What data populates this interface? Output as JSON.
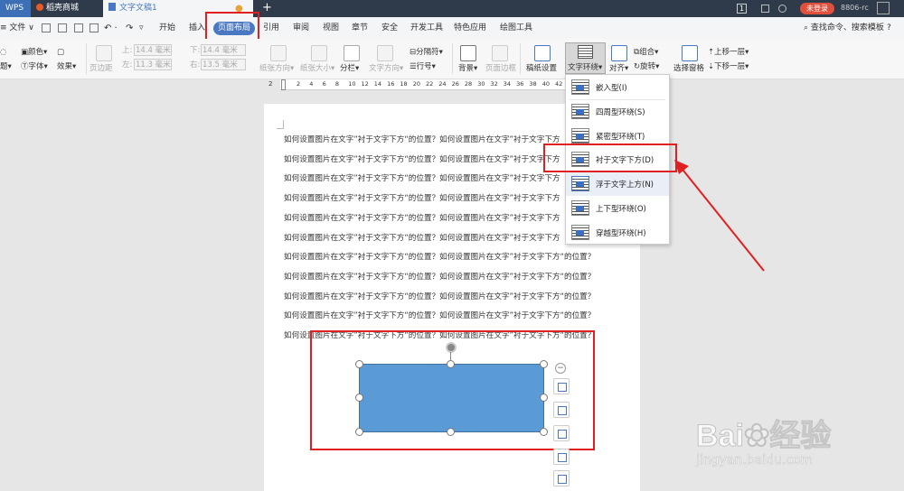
{
  "titlebar": {
    "tabs": [
      {
        "label": "WPS"
      },
      {
        "label": "稻壳商城"
      },
      {
        "label": "文字文稿1"
      }
    ],
    "new_tab": "+",
    "page_count": "1",
    "login_button": "未登录",
    "user_id": "8806-rc"
  },
  "menu": {
    "file": "文件",
    "items": [
      "开始",
      "插入",
      "页面布局",
      "引用",
      "审阅",
      "视图",
      "章节",
      "安全",
      "开发工具",
      "特色应用",
      "绘图工具"
    ],
    "search": "查找命令、搜索模板",
    "help": "?"
  },
  "ribbon": {
    "theme": "题",
    "colors": "颜色",
    "fonts": "字体",
    "effects": "效果",
    "margins": "页边距",
    "top_label": "上:",
    "top_value": "14.4 毫米",
    "bottom_label": "下:",
    "bottom_value": "14.4 毫米",
    "left_label": "左:",
    "left_value": "11.3 毫米",
    "right_label": "右:",
    "right_value": "13.5 毫米",
    "orientation": "纸张方向",
    "size": "纸张大小",
    "columns": "分栏",
    "text_direction": "文字方向",
    "separator": "分隔符",
    "line_numbers": "行号",
    "background": "背景",
    "page_border": "页面边框",
    "manuscript": "稿纸设置",
    "text_wrap": "文字环绕",
    "align": "对齐",
    "group": "组合",
    "rotate": "旋转",
    "selection_pane": "选择窗格",
    "bring_forward": "上移一层",
    "send_backward": "下移一层"
  },
  "ruler": {
    "start": "2",
    "marks": [
      "2",
      "4",
      "6",
      "8",
      "10",
      "12",
      "14",
      "16",
      "18",
      "20",
      "22",
      "24",
      "26",
      "28",
      "30",
      "32",
      "34",
      "36",
      "38",
      "40",
      "42"
    ]
  },
  "document": {
    "lines_short": [
      "如何设置图片在文字”衬于文字下方“的位置？如何设置图片在文字”衬于文字下方",
      "如何设置图片在文字”衬于文字下方“的位置？如何设置图片在文字”衬于文字下方",
      "如何设置图片在文字”衬于文字下方“的位置？如何设置图片在文字”衬于文字下方",
      "如何设置图片在文字”衬于文字下方“的位置？如何设置图片在文字”衬于文字下方",
      "如何设置图片在文字”衬于文字下方“的位置？如何设置图片在文字”衬于文字下方",
      "如何设置图片在文字”衬于文字下方“的位置？如何设置图片在文字”衬于文字下方"
    ],
    "lines_full": [
      "如何设置图片在文字”衬于文字下方“的位置？如何设置图片在文字”衬于文字下方“的位置？",
      "如何设置图片在文字”衬于文字下方“的位置？如何设置图片在文字”衬于文字下方“的位置？",
      "如何设置图片在文字”衬于文字下方“的位置？如何设置图片在文字”衬于文字下方“的位置？",
      "如何设置图片在文字”衬于文字下方“的位置？如何设置图片在文字”衬于文字下方“的位置？",
      "如何设置图片在文字”衬于文字下方“的位置？如何设置图片在文字”衬于文字下方“的位置？"
    ]
  },
  "shape": {
    "fill": "#5b9bd5"
  },
  "wrap_menu": {
    "items": [
      "嵌入型(I)",
      "四周型环绕(S)",
      "紧密型环绕(T)",
      "衬于文字下方(D)",
      "浮于文字上方(N)",
      "上下型环绕(O)",
      "穿越型环绕(H)"
    ]
  },
  "watermark": {
    "brand": "Bai",
    "brand2": "经验",
    "url": "jingyan.baidu.com"
  },
  "colors": {
    "accent": "#4a78c2",
    "highlight": "#e02020",
    "titlebar": "#2f3b4b",
    "login": "#e0503c"
  }
}
